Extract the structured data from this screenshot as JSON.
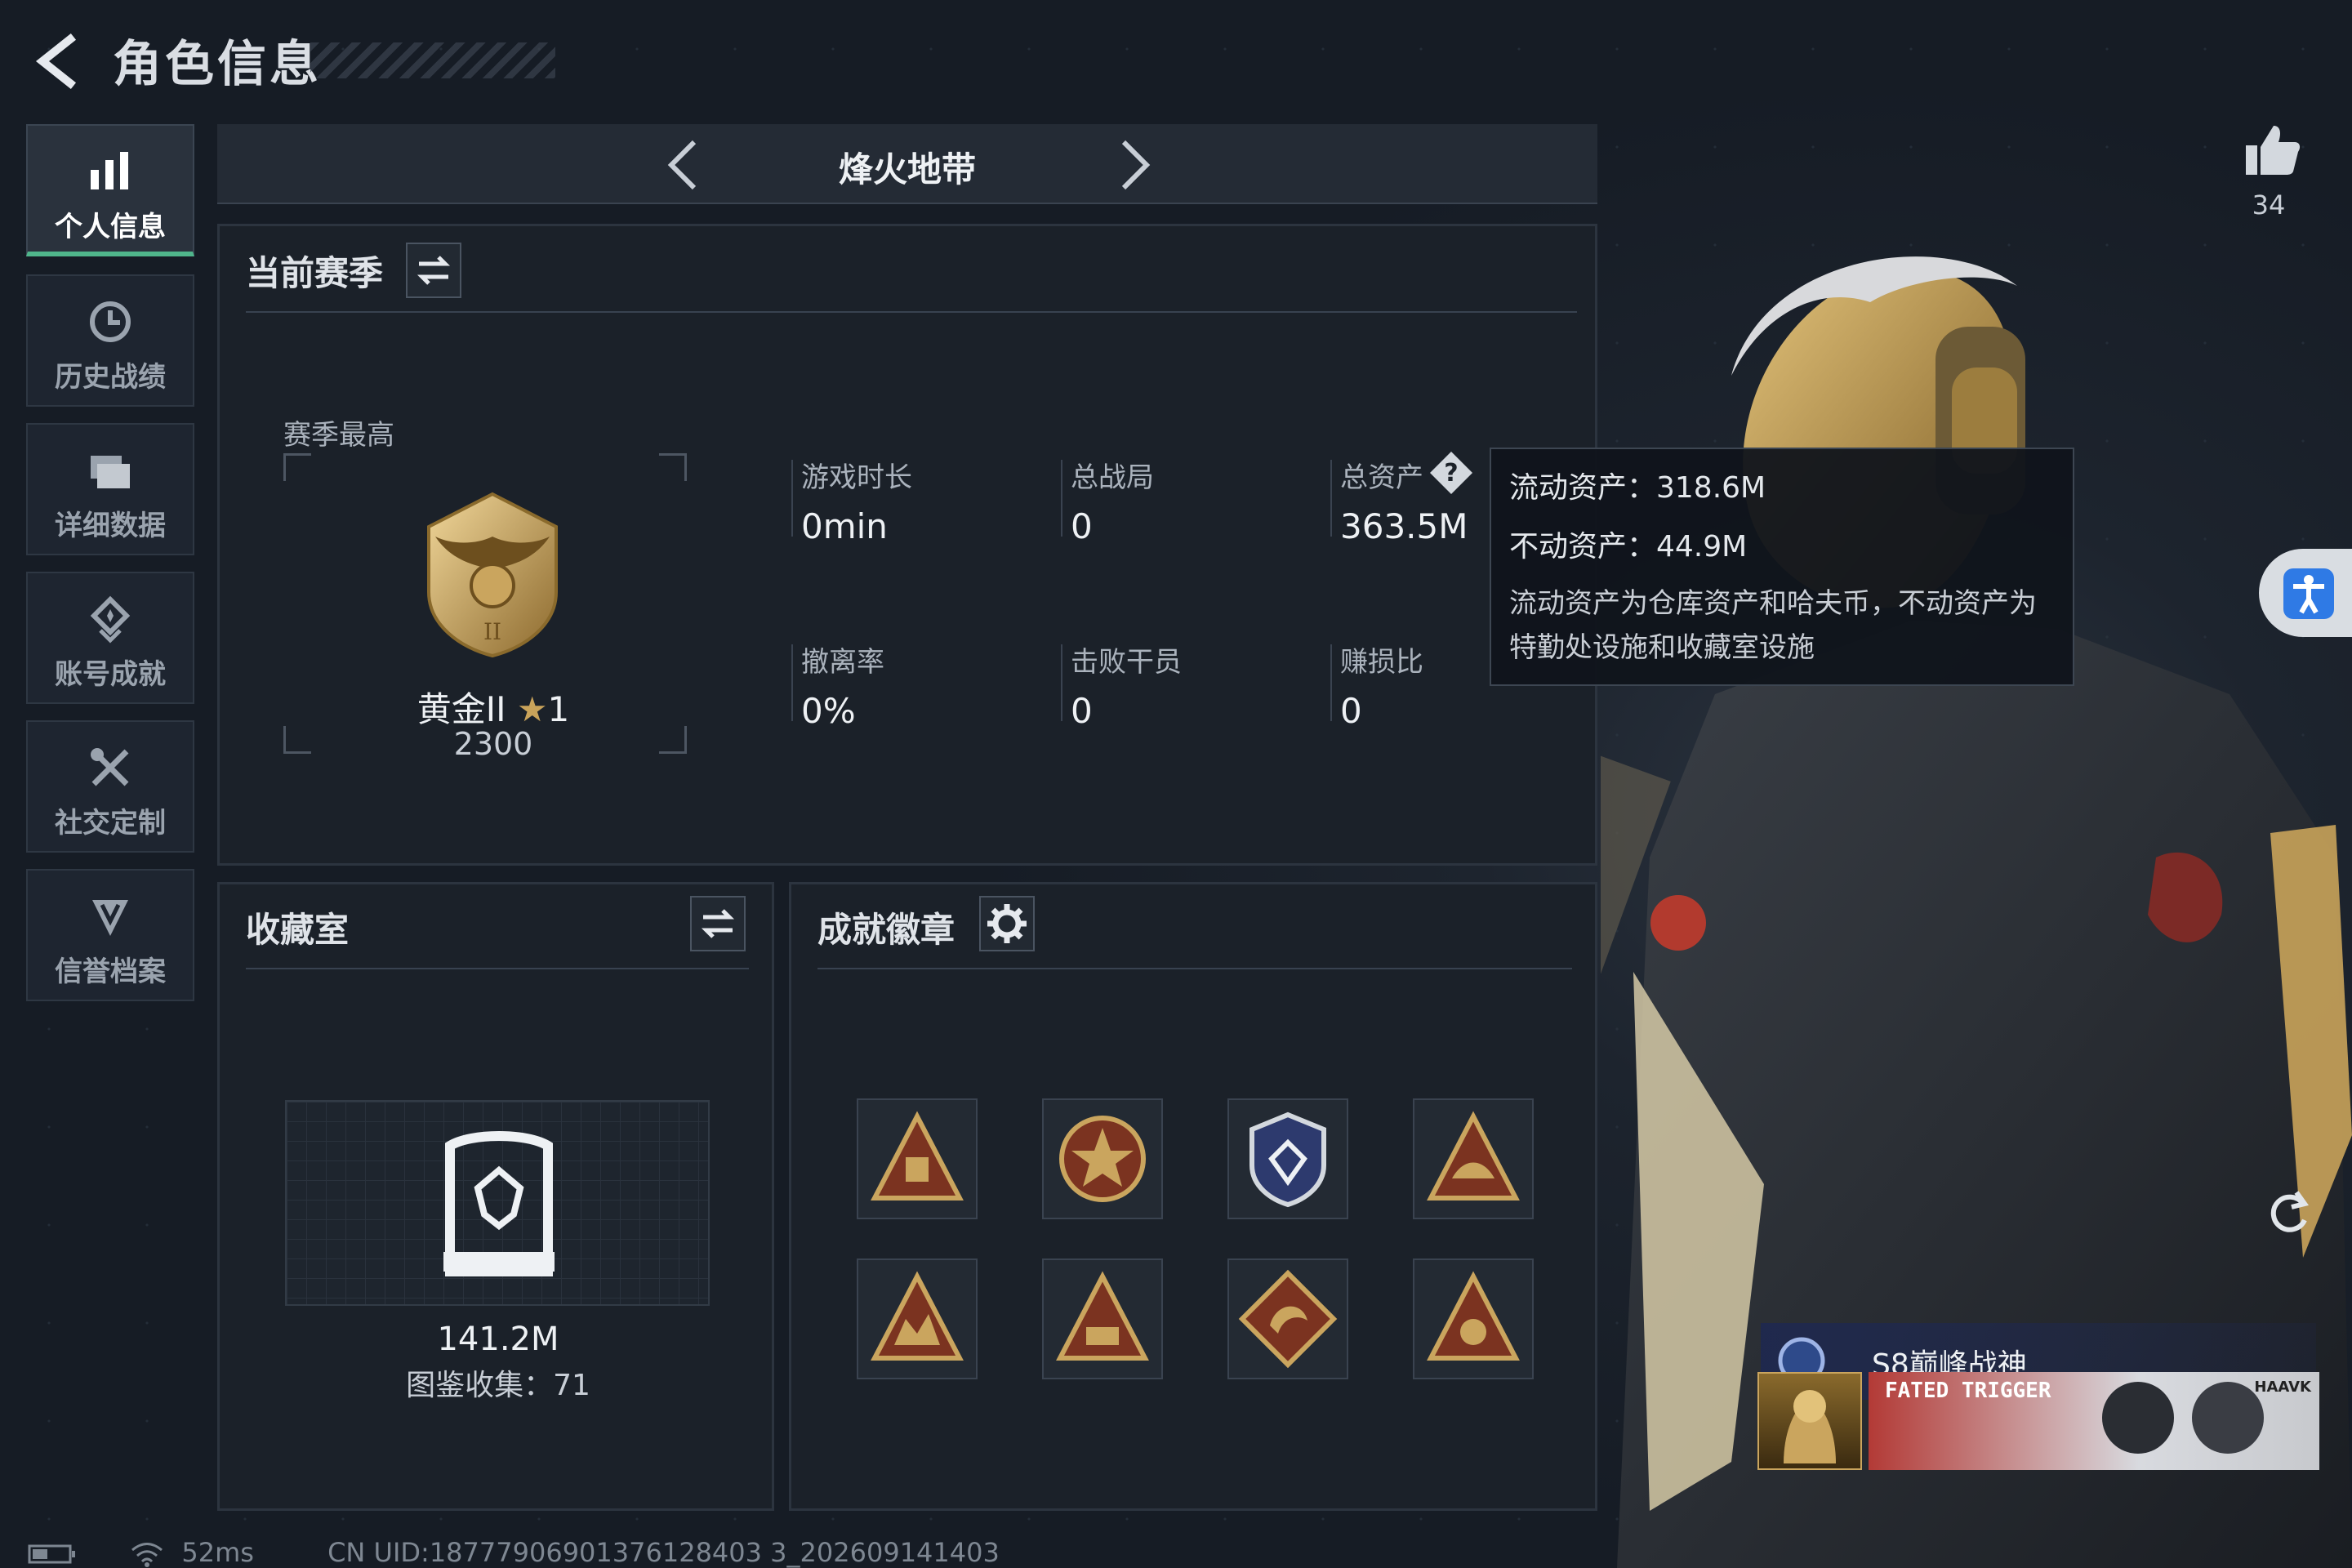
{
  "header": {
    "title": "角色信息"
  },
  "sidebar": {
    "items": [
      {
        "label": "个人信息",
        "active": true,
        "icon": "bar-chart-icon"
      },
      {
        "label": "历史战绩",
        "icon": "history-clock-icon"
      },
      {
        "label": "详细数据",
        "icon": "folder-data-icon"
      },
      {
        "label": "账号成就",
        "icon": "achievement-medal-icon"
      },
      {
        "label": "社交定制",
        "icon": "tools-cross-icon"
      },
      {
        "label": "信誉档案",
        "icon": "credit-shield-icon"
      }
    ]
  },
  "mode": {
    "name": "烽火地带"
  },
  "likes": {
    "count": "34"
  },
  "season": {
    "title": "当前赛季",
    "best_label": "赛季最高",
    "rank_name": "黄金II",
    "rank_star": "1",
    "rank_score": "2300",
    "stats": [
      {
        "label": "游戏时长",
        "value": "0min"
      },
      {
        "label": "总战局",
        "value": "0"
      },
      {
        "label": "总资产",
        "value": "363.5M"
      },
      {
        "label": "撤离率",
        "value": "0%"
      },
      {
        "label": "击败干员",
        "value": "0"
      },
      {
        "label": "赚损比",
        "value": "0"
      }
    ]
  },
  "tooltip": {
    "liquid": "流动资产：318.6M",
    "fixed": "不动资产：44.9M",
    "desc": "流动资产为仓库资产和哈夫币，不动资产为特勤处设施和收藏室设施"
  },
  "collection": {
    "title": "收藏室",
    "value": "141.2M",
    "count_text": "图鉴收集：71"
  },
  "badges": {
    "title": "成就徽章",
    "items": [
      "badge-1",
      "badge-2",
      "badge-3",
      "badge-4",
      "badge-5",
      "badge-6",
      "badge-7",
      "badge-8"
    ]
  },
  "player_card": {
    "title": "S8巅峰战神",
    "banner_text": "FATED TRIGGER",
    "corner_text": "HAAVK"
  },
  "footer": {
    "ping": "52ms",
    "uid": "CN UID:18777906901376128403 3_202609141403"
  },
  "colors": {
    "accent_green": "#4fb58b",
    "gold": "#c9a35a",
    "bg": "#171d26"
  }
}
